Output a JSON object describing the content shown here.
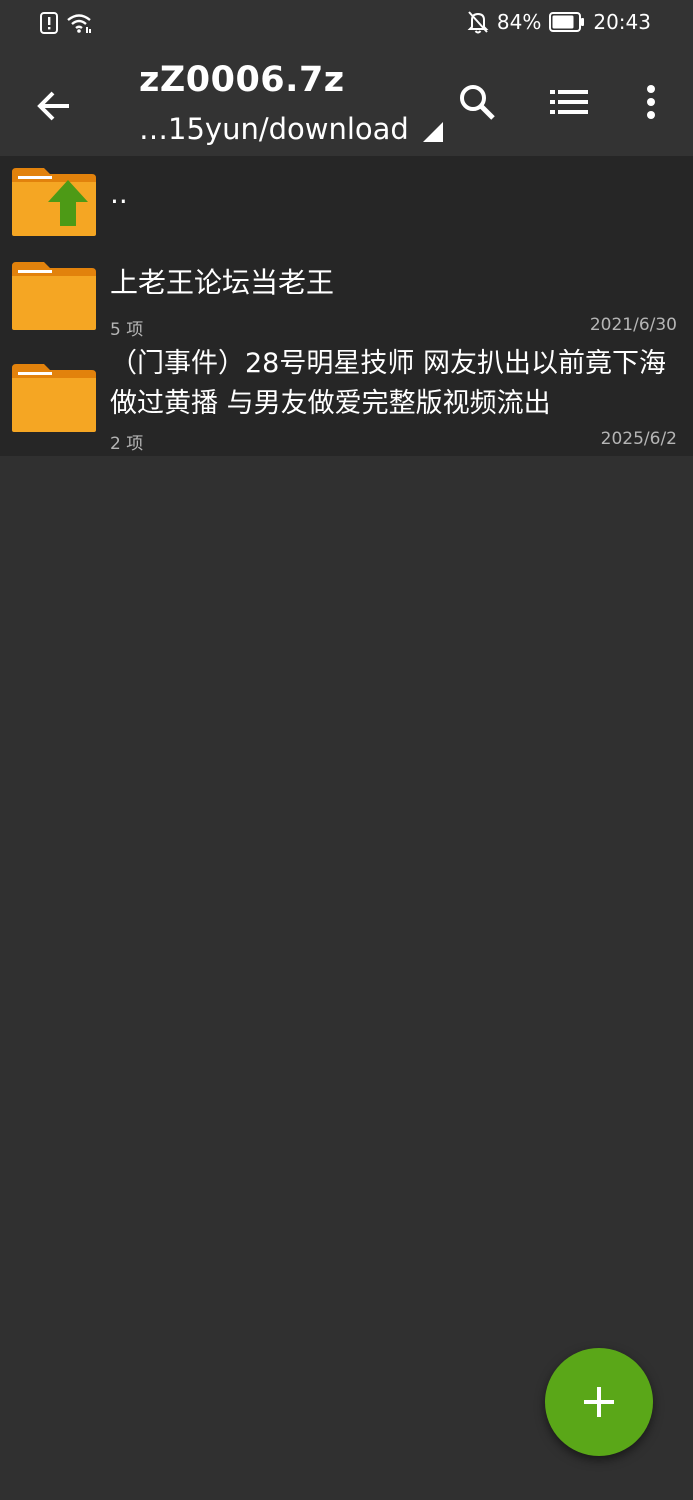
{
  "status_bar": {
    "battery_percent": "84%",
    "time": "20:43",
    "battery_level": 0.84,
    "icons": [
      "alert-icon",
      "wifi-icon",
      "bell-off-icon",
      "battery-icon"
    ]
  },
  "app_bar": {
    "title": "zZ0006.7z",
    "path": "…15yun/download",
    "icons": [
      "back-arrow-icon",
      "search-icon",
      "list-view-icon",
      "more-vert-icon"
    ]
  },
  "file_list": {
    "parent": {
      "name": ".."
    },
    "items": [
      {
        "name": "上老王论坛当老王",
        "meta": "5 项",
        "date": "2021/6/30"
      },
      {
        "name": "（门事件）28号明星技师 网友扒出以前竟下海做过黄播 与男友做爱完整版视频流出",
        "meta": "2 项",
        "date": "2025/6/2"
      }
    ]
  },
  "colors": {
    "background": "#303030",
    "app_bar": "#333333",
    "list_background": "#262626",
    "folder": "#f5a623",
    "folder_tab": "#e2820c",
    "parent_arrow": "#4d9a16",
    "fab": "#5aa718"
  },
  "fab": {
    "icon": "plus-icon"
  }
}
